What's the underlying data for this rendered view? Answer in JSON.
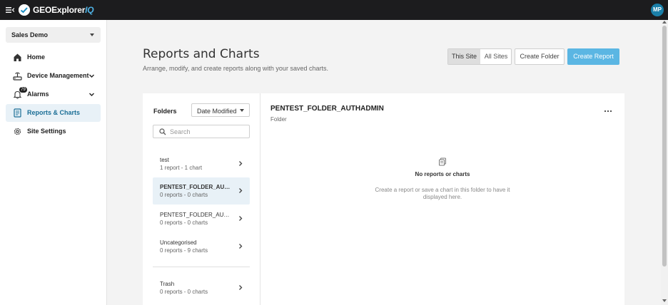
{
  "app": {
    "brand_main": "GEOExplorer",
    "brand_suffix": "IQ",
    "brand_color": "#4fb3e6",
    "user_initials": "MP",
    "menu_icon": "collapse-menu-icon"
  },
  "sidebar": {
    "site_selector": "Sales Demo",
    "items": [
      {
        "label": "Home",
        "icon": "home-icon"
      },
      {
        "label": "Device Management",
        "icon": "device-icon",
        "has_chevron": true
      },
      {
        "label": "Alarms",
        "icon": "bell-icon",
        "badge": "79",
        "has_chevron": true
      },
      {
        "label": "Reports & Charts",
        "icon": "report-icon",
        "active": true
      },
      {
        "label": "Site Settings",
        "icon": "gear-icon"
      }
    ]
  },
  "header": {
    "title": "Reports and Charts",
    "subtitle": "Arrange, modify, and create reports along with your saved charts.",
    "scope_toggle": {
      "this_site": "This Site",
      "all_sites": "All Sites",
      "selected": "This Site"
    },
    "create_folder": "Create Folder",
    "create_report": "Create Report",
    "accent": "#5bb6e3"
  },
  "folders_panel": {
    "label": "Folders",
    "sort_value": "Date Modified",
    "search_placeholder": "Search",
    "items": [
      {
        "name": "test",
        "meta": "1 report - 1 chart"
      },
      {
        "name": "PENTEST_FOLDER_AUTHADMIN",
        "meta": "0 reports - 0 charts",
        "selected": true
      },
      {
        "name": "PENTEST_FOLDER_AUTHRO",
        "meta": "0 reports - 0 charts"
      },
      {
        "name": "Uncategorised",
        "meta": "0 reports - 9 charts"
      },
      {
        "name": "Trash",
        "meta": "0 reports - 0 charts"
      }
    ]
  },
  "folder_detail": {
    "title": "PENTEST_FOLDER_AUTHADMIN",
    "type": "Folder",
    "empty_title": "No reports or charts",
    "empty_description": "Create a report or save a chart in this folder to have it displayed here."
  }
}
